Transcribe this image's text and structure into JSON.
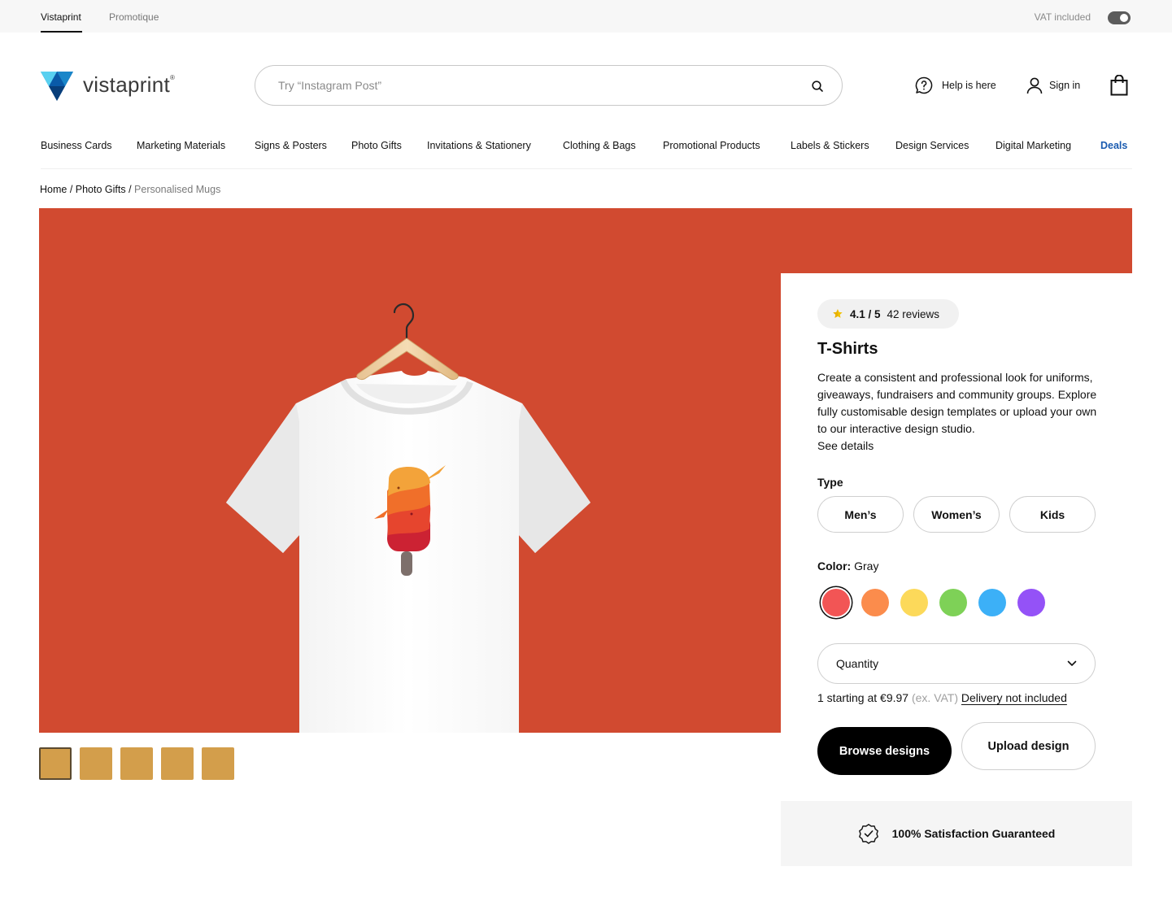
{
  "topbar": {
    "brands": [
      "Vistaprint",
      "Promotique"
    ],
    "vat_label": "VAT included",
    "vat_toggle_on": true
  },
  "header": {
    "logo_text": "vistaprint",
    "logo_mark": "®",
    "search_placeholder": "Try “Instagram Post”",
    "help_label": "Help is here",
    "signin_label": "Sign in"
  },
  "nav": {
    "items": [
      "Business Cards",
      "Marketing Materials",
      "Signs & Posters",
      "Photo Gifts",
      "Invitations & Stationery",
      "Clothing & Bags",
      "Promotional Products",
      "Labels & Stickers",
      "Design Services",
      "Digital Marketing",
      "Deals"
    ]
  },
  "breadcrumb": {
    "home": "Home",
    "sep": " / ",
    "parent": "Photo Gifts",
    "current": "Personalised Mugs"
  },
  "gallery": {
    "thumb_count": 5,
    "selected_index": 0,
    "hero_color": "#d14a30",
    "thumb_color": "#d39e4b"
  },
  "product": {
    "rating_score": "4.1 / 5",
    "rating_reviews": "42 reviews",
    "title": "T-Shirts",
    "description": "Create a consistent and professional look for uniforms, giveaways, fundraisers and community groups. Explore fully customisable design templates or upload your own to our interactive design studio.",
    "see_details": "See details",
    "type_label": "Type",
    "types": [
      "Men’s",
      "Women’s",
      "Kids"
    ],
    "color_label": "Color:",
    "color_value": "Gray",
    "swatches": [
      "#f25555",
      "#fb8c4c",
      "#fcd95a",
      "#7ed157",
      "#3cb0f7",
      "#9452f7"
    ],
    "selected_swatch": 0,
    "quantity_label": "Quantity",
    "price_prefix": "1 starting at €9.97",
    "price_exvat": "(ex. VAT)",
    "delivery": "Delivery not included",
    "browse_label": "Browse designs",
    "upload_label": "Upload design",
    "guarantee": "100% Satisfaction Guaranteed"
  }
}
